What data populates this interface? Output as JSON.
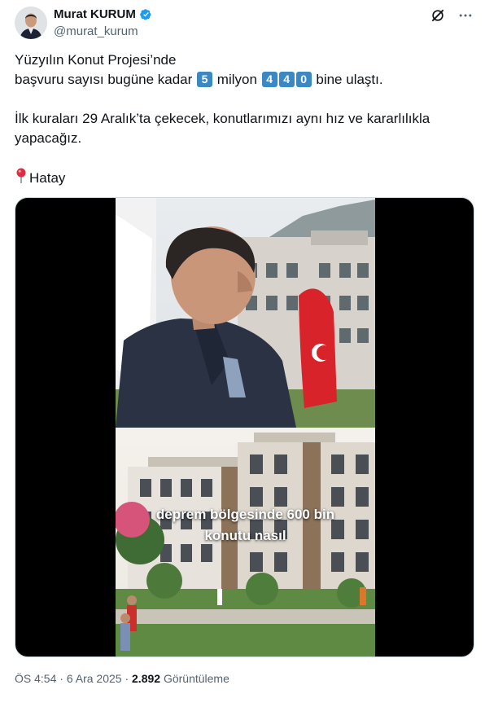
{
  "author": {
    "name": "Murat KURUM",
    "handle": "@murat_kurum"
  },
  "icons": {
    "verified": "verified-badge-icon",
    "grok": "grok-icon",
    "more": "more-options-icon",
    "pin": "round-pushpin-icon"
  },
  "colors": {
    "verified": "#1d9bf0",
    "keycap": "#3b88c3",
    "pin": "#dd2e44"
  },
  "tweet": {
    "line1": "Yüzyılın Konut Projesi’nde",
    "line2_a": "başvuru sayısı bugüne kadar",
    "key_5": "5",
    "line2_b": "milyon",
    "key_4a": "4",
    "key_4b": "4",
    "key_0": "0",
    "line2_c": "bine ulaştı.",
    "line3": "İlk kuraları 29 Aralık’ta çekecek, konutlarımızı aynı hız ve kararlılıkla yapacağız.",
    "location": "Hatay"
  },
  "media": {
    "caption_line1": "deprem bölgesinde 600 bin",
    "caption_line2": "konutu nasıl"
  },
  "meta": {
    "time": "ÖS 4:54",
    "sep1": "·",
    "date": "6 Ara 2025",
    "sep2": "·",
    "views": "2.892",
    "views_label": "Görüntüleme"
  }
}
